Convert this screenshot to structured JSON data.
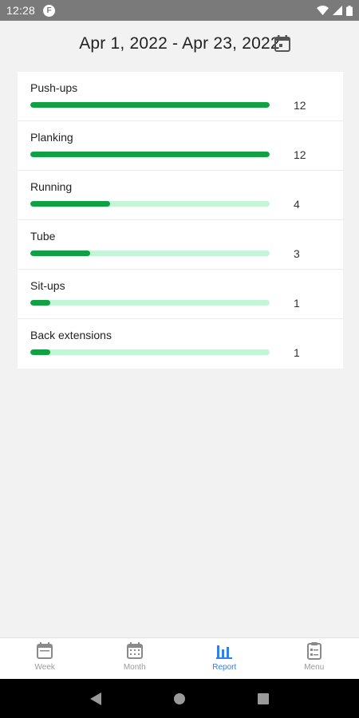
{
  "status_bar": {
    "time": "12:28",
    "app_icon_letter": "F"
  },
  "header": {
    "date_range": "Apr 1, 2022 - Apr 23, 2022"
  },
  "exercises": [
    {
      "name": "Push-ups",
      "count": "12",
      "fraction": 1.0
    },
    {
      "name": "Planking",
      "count": "12",
      "fraction": 1.0
    },
    {
      "name": "Running",
      "count": "4",
      "fraction": 0.333
    },
    {
      "name": "Tube",
      "count": "3",
      "fraction": 0.25
    },
    {
      "name": "Sit-ups",
      "count": "1",
      "fraction": 0.083
    },
    {
      "name": "Back extensions",
      "count": "1",
      "fraction": 0.083
    }
  ],
  "bottom_nav": {
    "items": [
      {
        "label": "Week",
        "icon": "calendar-week-icon"
      },
      {
        "label": "Month",
        "icon": "calendar-month-icon"
      },
      {
        "label": "Report",
        "icon": "bar-chart-icon",
        "active": true
      },
      {
        "label": "Menu",
        "icon": "clipboard-menu-icon"
      }
    ]
  },
  "colors": {
    "bar_fill": "#12a045",
    "bar_track": "#c4f5d6",
    "active_nav": "#2f7ff0",
    "inactive_nav": "#9a9a9a"
  }
}
